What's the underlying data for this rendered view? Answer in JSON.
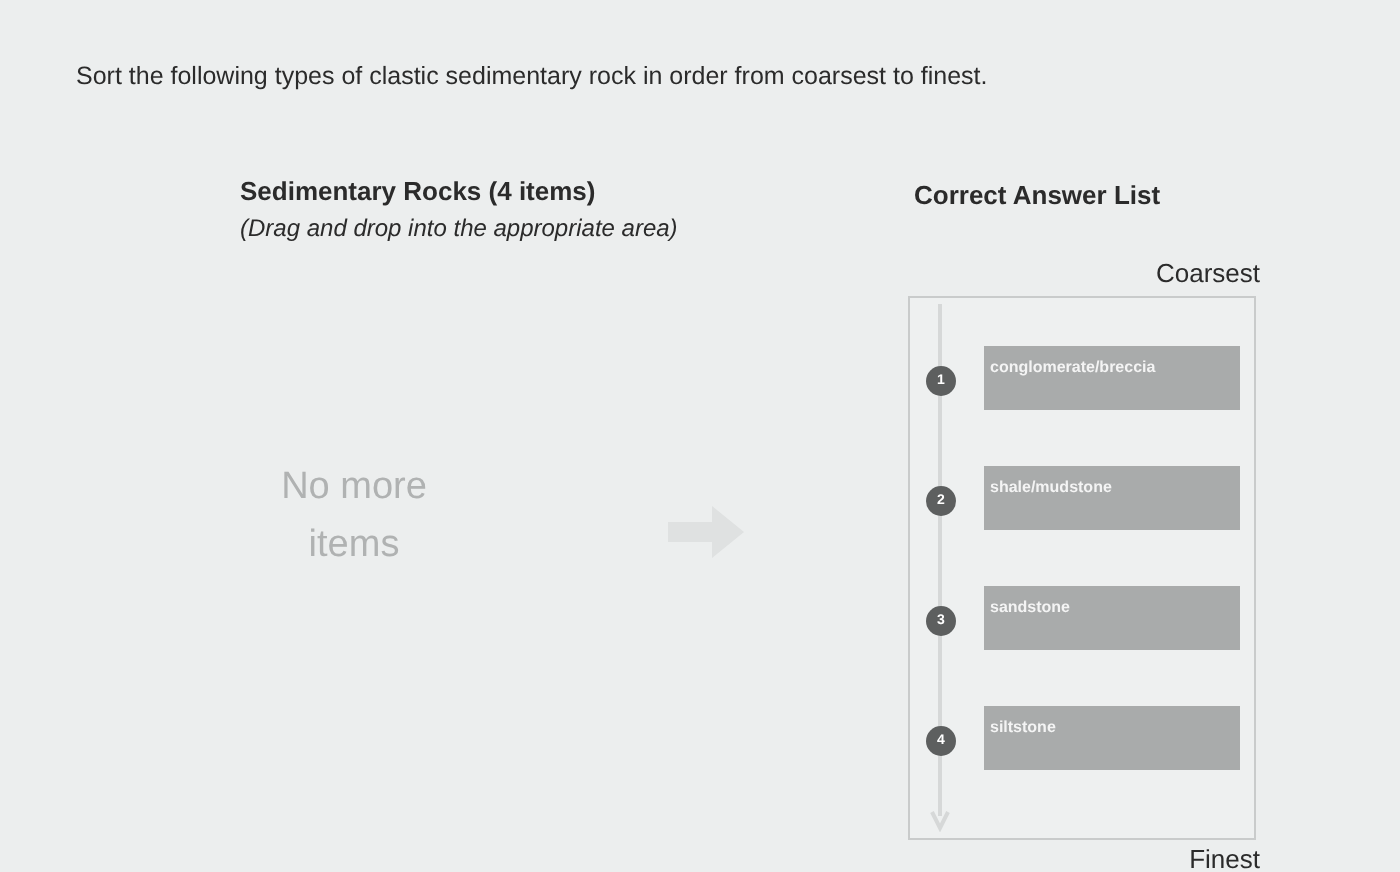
{
  "question": "Sort the following types of clastic sedimentary rock in order from coarsest to finest.",
  "source": {
    "title": "Sedimentary Rocks (4 items)",
    "instruction": "(Drag and drop into the appropriate area)",
    "empty_text": "No more items"
  },
  "answer_list": {
    "title": "Correct Answer List",
    "top_label": "Coarsest",
    "bottom_label": "Finest",
    "items": [
      {
        "number": "1",
        "label": "conglomerate/breccia"
      },
      {
        "number": "2",
        "label": "shale/mudstone"
      },
      {
        "number": "3",
        "label": "sandstone"
      },
      {
        "number": "4",
        "label": "siltstone"
      }
    ]
  }
}
